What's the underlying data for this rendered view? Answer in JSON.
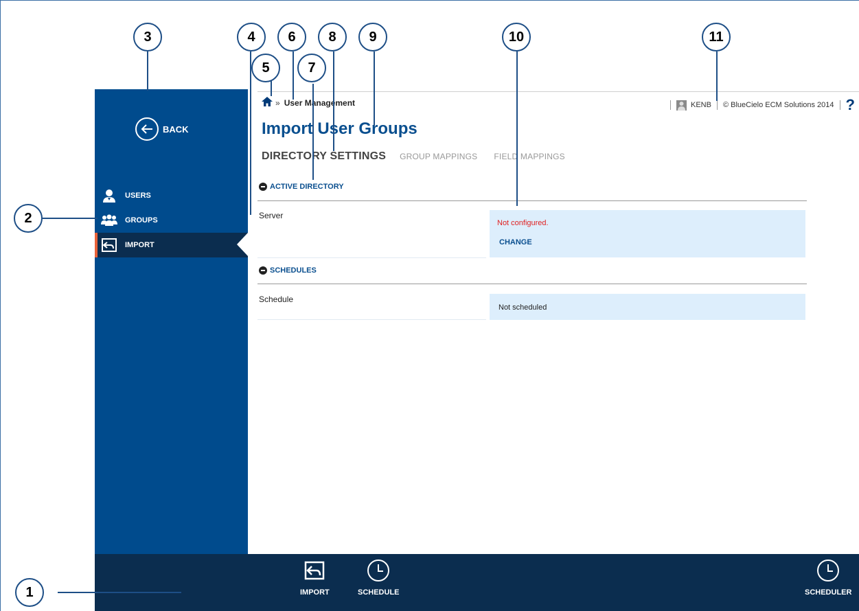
{
  "sidebar": {
    "back_label": "BACK",
    "items": [
      {
        "label": "USERS",
        "icon": "user-icon"
      },
      {
        "label": "GROUPS",
        "icon": "groups-icon"
      },
      {
        "label": "IMPORT",
        "icon": "import-icon",
        "active": true
      }
    ]
  },
  "header": {
    "breadcrumb_current": "User Management",
    "breadcrumb_separator": "»",
    "username": "KENB",
    "copyright": "© BlueCielo ECM Solutions 2014",
    "help": "?"
  },
  "page": {
    "title": "Import User Groups",
    "tabs": [
      "DIRECTORY SETTINGS",
      "GROUP MAPPINGS",
      "FIELD MAPPINGS"
    ],
    "active_tab": "DIRECTORY SETTINGS"
  },
  "sections": {
    "active_directory": {
      "title": "ACTIVE DIRECTORY",
      "field_label": "Server",
      "status": "Not configured.",
      "action": "CHANGE"
    },
    "schedules": {
      "title": "SCHEDULES",
      "field_label": "Schedule",
      "value": "Not scheduled"
    }
  },
  "bottombar": {
    "items": [
      "IMPORT",
      "SCHEDULE"
    ],
    "right_item": "SCHEDULER"
  },
  "callouts": [
    "1",
    "2",
    "3",
    "4",
    "5",
    "6",
    "7",
    "8",
    "9",
    "10",
    "11"
  ],
  "colors": {
    "sidebar": "#004b8d",
    "bottombar": "#0b2d4f",
    "active_indicator": "#e8623a",
    "title": "#0a4f8f",
    "value_box": "#ddeefc",
    "error": "#e02020"
  }
}
